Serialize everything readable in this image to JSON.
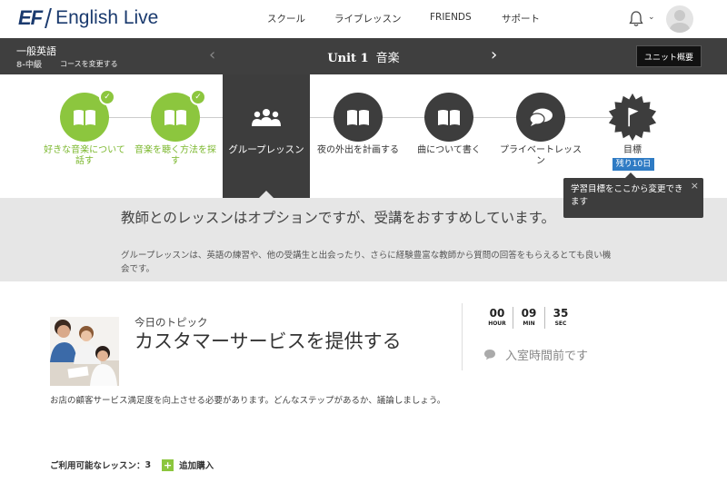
{
  "header": {
    "logo_mark": "EF",
    "logo_text": "English Live",
    "nav": [
      "スクール",
      "ライブレッスン",
      "FRIENDS",
      "サポート"
    ]
  },
  "unit_bar": {
    "course_name": "一般英語",
    "course_level": "8-中級",
    "change_course": "コースを変更する",
    "unit_number": "Unit 1",
    "unit_name": "音楽",
    "overview_button": "ユニット概要"
  },
  "steps": [
    {
      "label": "好きな音楽について話す",
      "state": "done",
      "icon": "book-icon"
    },
    {
      "label": "音楽を聴く方法を探す",
      "state": "done",
      "icon": "book-icon"
    },
    {
      "label": "グループレッスン",
      "state": "active",
      "icon": "group-icon"
    },
    {
      "label": "夜の外出を計画する",
      "state": "todo",
      "icon": "book-icon"
    },
    {
      "label": "曲について書く",
      "state": "todo",
      "icon": "book-icon"
    },
    {
      "label": "プライベートレッスン",
      "state": "todo",
      "icon": "chat-icon"
    },
    {
      "label": "目標",
      "state": "goal",
      "icon": "flag-icon",
      "badge": "残り10日"
    }
  ],
  "tooltip": {
    "text": "学習目標をここから変更できます",
    "close": "×"
  },
  "info": {
    "title": "教師とのレッスンはオプションですが、受講をおすすめしています。",
    "description": "グループレッスンは、英語の練習や、他の受講生と出会ったり、さらに経験豊富な教師から質問の回答をもらえるとても良い機会です。"
  },
  "topic": {
    "kicker": "今日のトピック",
    "title": "カスタマーサービスを提供する",
    "description": "お店の顧客サービス満足度を向上させる必要があります。どんなステップがあるか、議論しましょう。"
  },
  "timer": {
    "hours": "00",
    "hours_label": "HOUR",
    "minutes": "09",
    "minutes_label": "MIN",
    "seconds": "35",
    "seconds_label": "SEC"
  },
  "status_text": "入室時間前です",
  "lessons": {
    "label": "ご利用可能なレッスン：",
    "count": "3",
    "buy_label": "追加購入"
  },
  "colors": {
    "done_green": "#8cc63e",
    "dark": "#3d3d3d",
    "badge_blue": "#2f7bc4",
    "brand_navy": "#1a3a6e"
  }
}
